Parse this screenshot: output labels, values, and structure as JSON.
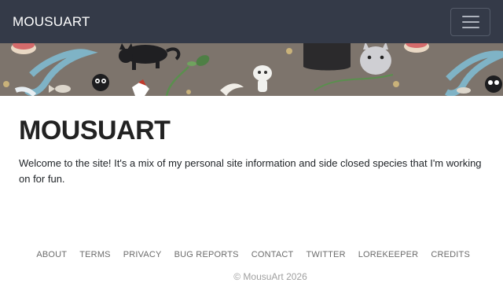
{
  "navbar": {
    "brand": "MOUSUART",
    "toggle_icon": "hamburger-menu-icon",
    "background": "#343a48"
  },
  "banner": {
    "description_icons": [
      "cat-icon",
      "soot-sprite-icon",
      "kodama-icon",
      "totoro-icon",
      "leaf-icon",
      "fish-icon",
      "dragon-icon"
    ]
  },
  "main": {
    "title": "MOUSUART",
    "welcome_text": "Welcome to the site! It's a mix of my personal site information and side closed species that I'm working on for fun."
  },
  "footer": {
    "links": [
      "ABOUT",
      "TERMS",
      "PRIVACY",
      "BUG REPORTS",
      "CONTACT",
      "TWITTER",
      "LOREKEEPER",
      "CREDITS"
    ],
    "copyright": "© MousuArt 2026"
  }
}
